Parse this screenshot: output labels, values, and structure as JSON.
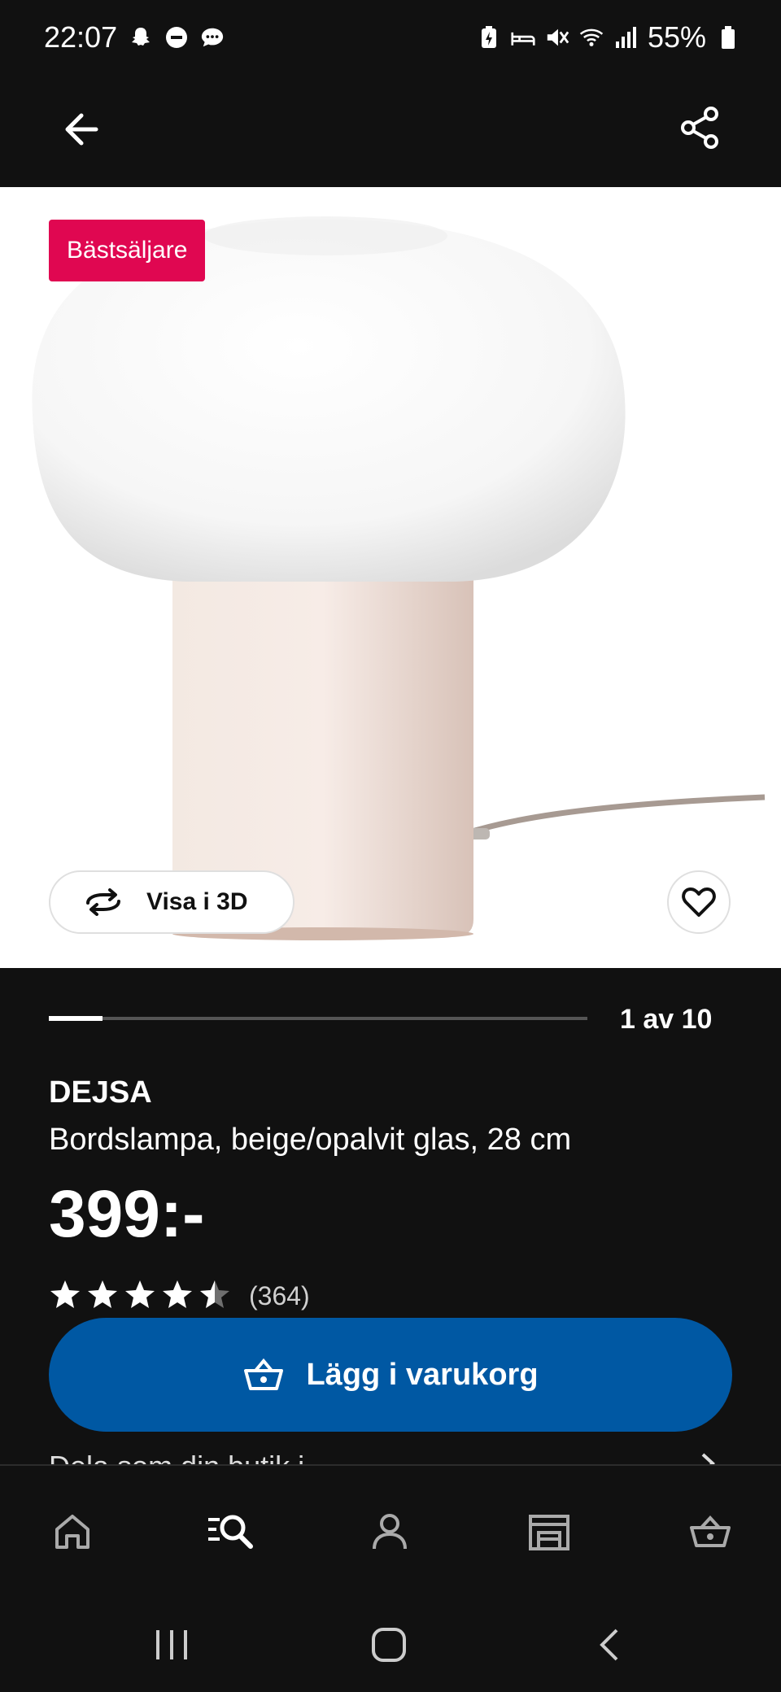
{
  "status_bar": {
    "time": "22:07",
    "battery": "55%"
  },
  "header": {
    "back_icon": "arrow-left-icon",
    "share_icon": "share-icon"
  },
  "hero": {
    "badge": "Bästsäljare",
    "view_3d_label": "Visa i 3D",
    "favorite_icon": "heart-icon",
    "image_index": "1 av 10",
    "image_progress": 0.1
  },
  "product": {
    "name": "DEJSA",
    "description": "Bordslampa, beige/opalvit glas, 28 cm",
    "price": "399:-",
    "rating": 4.5,
    "rating_count": "(364)",
    "add_to_cart_label": "Lägg i varukorg",
    "peek_text": "Dela som din butik i"
  },
  "bottom_nav": {
    "items": [
      "home-icon",
      "search-icon",
      "profile-icon",
      "store-icon",
      "cart-icon"
    ]
  },
  "colors": {
    "background": "#111111",
    "badge": "#e00751",
    "primary_button": "#0058a3"
  }
}
